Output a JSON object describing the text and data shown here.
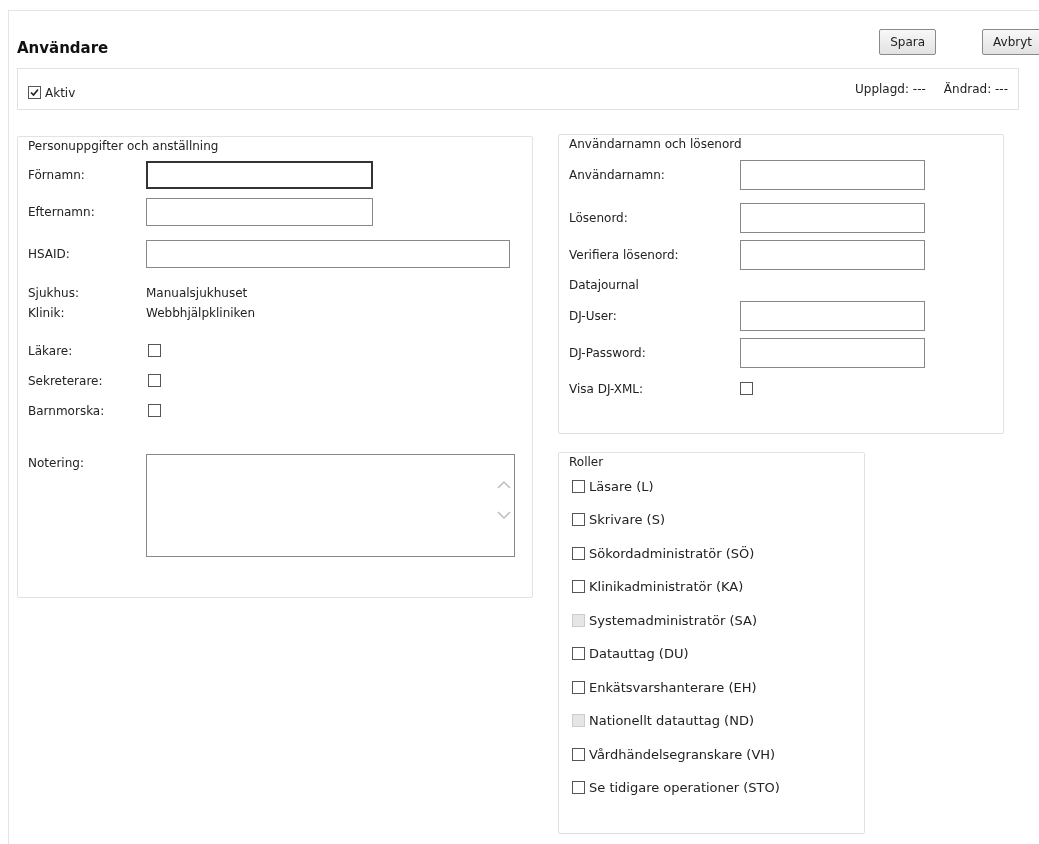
{
  "title": "Användare",
  "buttons": [
    {
      "label": "Spara"
    },
    {
      "label": "Avbryt"
    }
  ],
  "active": {
    "label": "Aktiv",
    "checked": true
  },
  "meta": [
    {
      "label": "Upplagd:",
      "value": "---"
    },
    {
      "label": "Ändrad:",
      "value": "---"
    }
  ],
  "personal": {
    "legend": "Personuppgifter och anställning",
    "rows": [
      {
        "kind": "input",
        "label": "Förnamn:",
        "focused": true
      },
      {
        "kind": "input",
        "label": "Efternamn:",
        "focused": false
      },
      {
        "kind": "wideinput",
        "label": "HSAID:",
        "focused": false
      },
      {
        "kind": "info",
        "label": "Sjukhus:",
        "value": "Manualsjukhuset"
      },
      {
        "kind": "info",
        "label": "Klinik:",
        "value": "Webbhjälpkliniken"
      },
      {
        "kind": "checkbox",
        "label": "Läkare:",
        "checked": false
      },
      {
        "kind": "checkbox",
        "label": "Sekreterare:",
        "checked": false
      },
      {
        "kind": "checkbox",
        "label": "Barnmorska:",
        "checked": false
      },
      {
        "kind": "textarea",
        "label": "Notering:"
      }
    ]
  },
  "account": {
    "legend": "Användarnamn och lösenord",
    "rows": [
      {
        "kind": "input",
        "label": "Användarnamn:"
      },
      {
        "kind": "input",
        "label": "Lösenord:"
      },
      {
        "kind": "input",
        "label": "Verifiera lösenord:"
      },
      {
        "kind": "heading",
        "label": "Datajournal"
      },
      {
        "kind": "input",
        "label": "DJ-User:"
      },
      {
        "kind": "input",
        "label": "DJ-Password:"
      },
      {
        "kind": "checkbox",
        "label": "Visa DJ-XML:",
        "checked": false
      }
    ]
  },
  "roles": {
    "legend": "Roller",
    "items": [
      {
        "label": "Läsare (L)",
        "checked": false,
        "disabled": false
      },
      {
        "label": "Skrivare (S)",
        "checked": false,
        "disabled": false
      },
      {
        "label": "Sökordadministratör (SÖ)",
        "checked": false,
        "disabled": false
      },
      {
        "label": "Klinikadministratör (KA)",
        "checked": false,
        "disabled": false
      },
      {
        "label": "Systemadministratör (SA)",
        "checked": false,
        "disabled": true
      },
      {
        "label": "Datauttag (DU)",
        "checked": false,
        "disabled": false
      },
      {
        "label": "Enkätsvarshanterare (EH)",
        "checked": false,
        "disabled": false
      },
      {
        "label": "Nationellt datauttag (ND)",
        "checked": false,
        "disabled": true
      },
      {
        "label": "Vårdhändelsegranskare (VH)",
        "checked": false,
        "disabled": false
      },
      {
        "label": "Se tidigare operationer (STO)",
        "checked": false,
        "disabled": false
      }
    ]
  }
}
